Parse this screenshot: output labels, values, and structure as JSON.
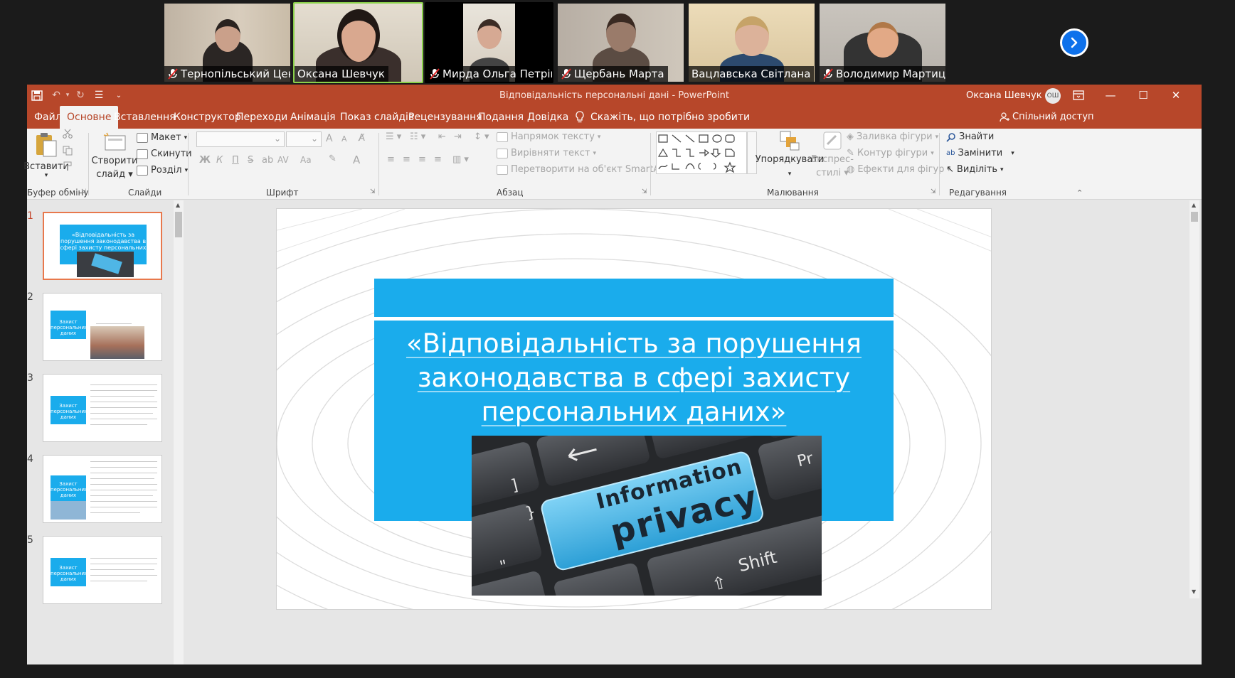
{
  "participants": [
    {
      "name": "Тернопільський Цент...",
      "muted": true,
      "active": false
    },
    {
      "name": "Оксана Шевчук",
      "muted": false,
      "active": true
    },
    {
      "name": "Мирда Ольга Петрівна",
      "muted": true,
      "active": false
    },
    {
      "name": "Щербань Марта",
      "muted": true,
      "active": false
    },
    {
      "name": "Вацлавська Світлана",
      "muted": false,
      "active": false
    },
    {
      "name": "Володимир Мартиць",
      "muted": true,
      "active": false
    }
  ],
  "app": {
    "doc_title": "Відповідальність персональні дані  -  PowerPoint",
    "user_name": "Оксана Шевчук",
    "user_initials": "ОШ",
    "accent": "#b7472a"
  },
  "tabs": [
    "Файл",
    "Основне",
    "Вставлення",
    "Конструктор",
    "Переходи",
    "Анімація",
    "Показ слайдів",
    "Рецензування",
    "Подання",
    "Довідка"
  ],
  "tell_me": "Скажіть, що потрібно зробити",
  "share": "Спільний доступ",
  "ribbon": {
    "clipboard": {
      "paste": "Вставити",
      "label": "Буфер обміну"
    },
    "slides": {
      "new_slide_1": "Створити",
      "new_slide_2": "слайд",
      "layout": "Макет",
      "reset": "Скинути",
      "section": "Розділ",
      "label": "Слайди"
    },
    "font": {
      "bold": "Ж",
      "italic": "К",
      "underline": "П",
      "strike": "S",
      "spacing": "AV",
      "case": "Aa",
      "color": "A",
      "grow": "A",
      "shrink": "A",
      "label": "Шрифт"
    },
    "paragraph": {
      "direction": "Напрямок тексту",
      "align": "Вирівняти текст",
      "smartart": "Перетворити на об'єкт SmartArt",
      "label": "Абзац"
    },
    "drawing": {
      "arrange": "Упорядкувати",
      "styles_1": "Експрес-",
      "styles_2": "стилі",
      "fill": "Заливка фігури",
      "outline": "Контур фігури",
      "effects": "Ефекти для фігур",
      "label": "Малювання"
    },
    "editing": {
      "find": "Знайти",
      "replace": "Замінити",
      "select": "Виділіть",
      "label": "Редагування"
    }
  },
  "thumbnails": [
    {
      "num": "1",
      "text": "«Відповідальність за порушення законодавства в сфері захисту персональних даних»"
    },
    {
      "num": "2",
      "text": "Захист персональних даних"
    },
    {
      "num": "3",
      "text": "Захист персональних даних"
    },
    {
      "num": "4",
      "text": "Захист персональних даних"
    },
    {
      "num": "5",
      "text": "Захист персональних даних"
    }
  ],
  "slide": {
    "title": "«Відповідальність за порушення законодавства в сфері захисту персональних даних»",
    "key_line1": "Information",
    "key_line2": "privacy",
    "key_shift": "Shift",
    "key_pr": "Pr",
    "box_color": "#1aacec"
  }
}
